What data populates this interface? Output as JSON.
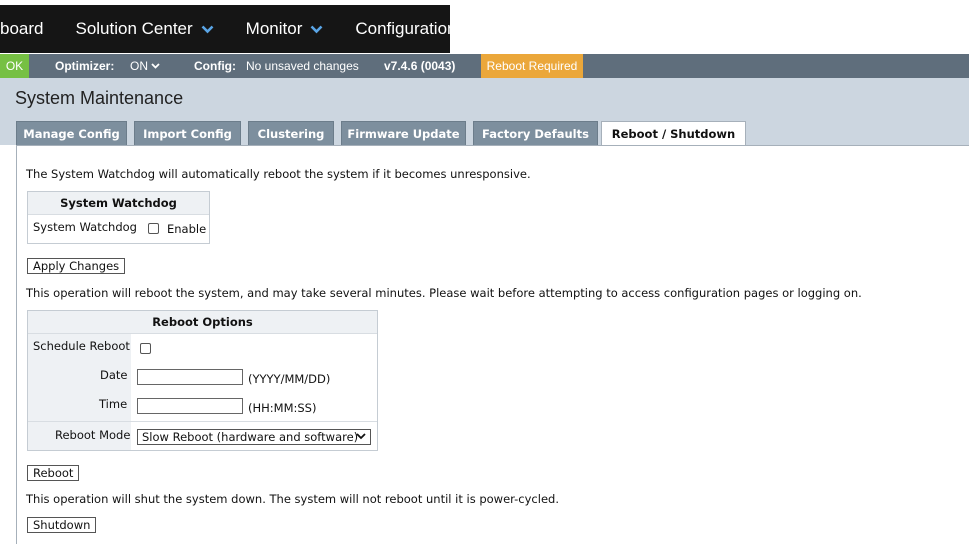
{
  "nav": {
    "items": [
      {
        "label": "board"
      },
      {
        "label": "Solution Center"
      },
      {
        "label": "Monitor"
      },
      {
        "label": "Configuration"
      }
    ]
  },
  "status": {
    "ok": "OK",
    "optimizer_label": "Optimizer:",
    "optimizer_value": "ON",
    "config_label": "Config:",
    "config_value": "No unsaved changes",
    "version": "v7.4.6 (0043)",
    "reboot_required": "Reboot Required"
  },
  "page": {
    "title": "System Maintenance",
    "tabs": [
      {
        "label": "Manage Config"
      },
      {
        "label": "Import Config"
      },
      {
        "label": "Clustering"
      },
      {
        "label": "Firmware Update"
      },
      {
        "label": "Factory Defaults"
      },
      {
        "label": "Reboot / Shutdown"
      }
    ],
    "active_tab": "Reboot / Shutdown"
  },
  "watchdog": {
    "description": "The System Watchdog will automatically reboot the system if it becomes unresponsive.",
    "panel_title": "System Watchdog",
    "row_label": "System Watchdog",
    "enable_label": "Enable",
    "enabled": false,
    "apply_button": "Apply Changes"
  },
  "reboot": {
    "description": "This operation will reboot the system, and may take several minutes. Please wait before attempting to access configuration pages or logging on.",
    "panel_title": "Reboot Options",
    "schedule_label": "Schedule Reboot",
    "schedule_checked": false,
    "date_label": "Date",
    "date_value": "",
    "date_hint": "(YYYY/MM/DD)",
    "time_label": "Time",
    "time_value": "",
    "time_hint": "(HH:MM:SS)",
    "mode_label": "Reboot Mode",
    "mode_value": "Slow Reboot (hardware and software)",
    "button": "Reboot"
  },
  "shutdown": {
    "description": "This operation will shut the system down. The system will not reboot until it is power-cycled.",
    "button": "Shutdown"
  },
  "colors": {
    "nav_bg": "#151515",
    "status_bar": "#5f6e7c",
    "ok_green": "#76c043",
    "reboot_orange": "#eba73a",
    "header_bg": "#ccd6e0",
    "tab_bg": "#7d8f9e"
  },
  "icons": {
    "nav_dropdown": "chevron-down-icon",
    "optimizer_dropdown": "chevron-down-icon",
    "select_dropdown": "chevron-down-icon"
  }
}
